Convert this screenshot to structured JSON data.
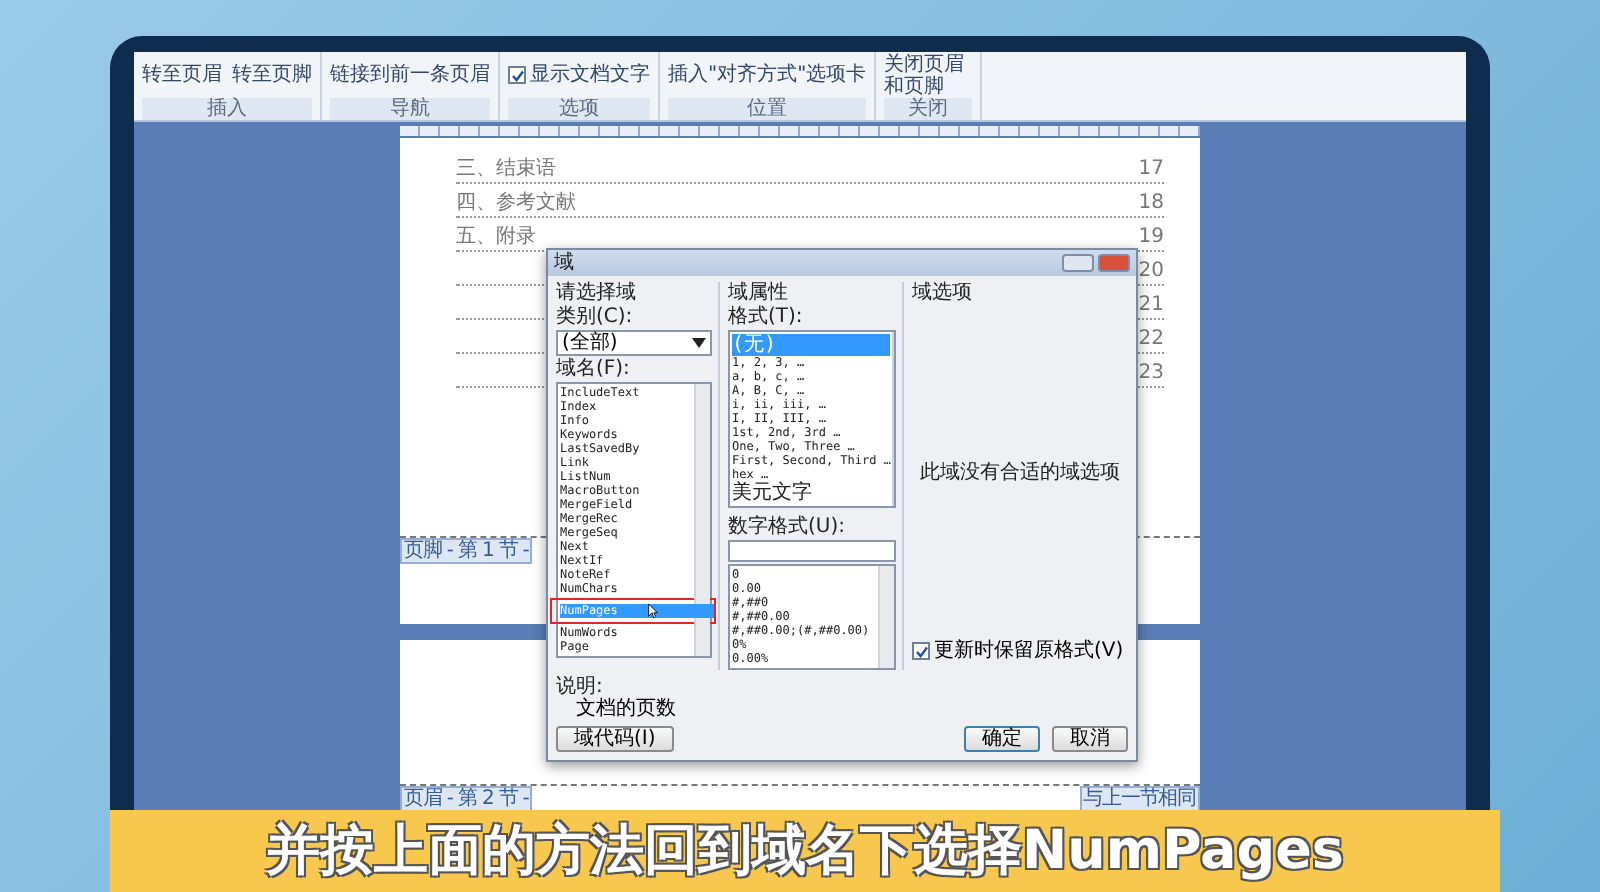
{
  "ribbon": {
    "groups": [
      {
        "label": "插入",
        "items": [
          {
            "kind": "button",
            "label": "转至页眉"
          },
          {
            "kind": "button",
            "label": "转至页脚"
          }
        ]
      },
      {
        "label": "导航",
        "items": [
          {
            "kind": "button",
            "label": "链接到前一条页眉"
          }
        ]
      },
      {
        "label": "选项",
        "items": [
          {
            "kind": "checkbox",
            "label": "显示文档文字",
            "checked": true
          }
        ]
      },
      {
        "label": "位置",
        "items": [
          {
            "kind": "button",
            "label": "插入\"对齐方式\"选项卡"
          }
        ]
      },
      {
        "label": "关闭",
        "items": [
          {
            "kind": "button",
            "label": "关闭页眉和页脚"
          }
        ]
      }
    ]
  },
  "document": {
    "toc": [
      {
        "title": "三、结束语",
        "page": "17"
      },
      {
        "title": "四、参考文献",
        "page": "18"
      },
      {
        "title": "五、附录",
        "page": "19"
      },
      {
        "page": "20"
      },
      {
        "page": "21"
      },
      {
        "page": "22"
      },
      {
        "page": "23"
      }
    ],
    "page1_footer_tag": "页脚 - 第 1 节 -",
    "page2_header_tag": "页眉 - 第 2 节 -",
    "page2_link_tag": "与上一节相同"
  },
  "dialog": {
    "title": "域",
    "left": {
      "heading": "请选择域",
      "category_label": "类别(C):",
      "category_value": "(全部)",
      "names_label": "域名(F):",
      "names": [
        {
          "label": "IncludeText",
          "selected": false
        },
        {
          "label": "Index",
          "selected": false
        },
        {
          "label": "Info",
          "selected": false
        },
        {
          "label": "Keywords",
          "selected": false
        },
        {
          "label": "LastSavedBy",
          "selected": false
        },
        {
          "label": "Link",
          "selected": false
        },
        {
          "label": "ListNum",
          "selected": false
        },
        {
          "label": "MacroButton",
          "selected": false
        },
        {
          "label": "MergeField",
          "selected": false
        },
        {
          "label": "MergeRec",
          "selected": false
        },
        {
          "label": "MergeSeq",
          "selected": false
        },
        {
          "label": "Next",
          "selected": false
        },
        {
          "label": "NextIf",
          "selected": false
        },
        {
          "label": "NoteRef",
          "selected": false
        },
        {
          "label": "NumChars",
          "selected": false
        },
        {
          "label": "NumPages",
          "selected": true
        },
        {
          "label": "NumWords",
          "selected": false
        },
        {
          "label": "Page",
          "selected": false
        }
      ]
    },
    "middle": {
      "heading": "域属性",
      "format_label": "格式(T):",
      "formats": [
        {
          "label": "(无)",
          "selected": true
        },
        {
          "label": "1, 2, 3, …",
          "selected": false
        },
        {
          "label": "a, b, c, …",
          "selected": false
        },
        {
          "label": "A, B, C, …",
          "selected": false
        },
        {
          "label": "i, ii, iii, …",
          "selected": false
        },
        {
          "label": "I, II, III, …",
          "selected": false
        },
        {
          "label": "1st, 2nd, 3rd …",
          "selected": false
        },
        {
          "label": "One, Two, Three …",
          "selected": false
        },
        {
          "label": "First, Second, Third …",
          "selected": false
        },
        {
          "label": "hex …",
          "selected": false
        },
        {
          "label": "美元文字",
          "selected": false
        }
      ],
      "number_label": "数字格式(U):",
      "number_formats": [
        "0",
        "0.00",
        "#,##0",
        "#,##0.00",
        "#,##0.00;(#,##0.00)",
        "0%",
        "0.00%"
      ]
    },
    "right": {
      "heading": "域选项",
      "message": "此域没有合适的域选项",
      "preserve": {
        "label": "更新时保留原格式(V)",
        "checked": true
      }
    },
    "description_label": "说明:",
    "description": "文档的页数",
    "buttons": [
      {
        "label": "域代码(I)",
        "kind": "secondary"
      },
      {
        "label": "确定",
        "kind": "default"
      },
      {
        "label": "取消",
        "kind": "secondary"
      }
    ]
  },
  "caption": "并按上面的方法回到域名下选择NumPages"
}
